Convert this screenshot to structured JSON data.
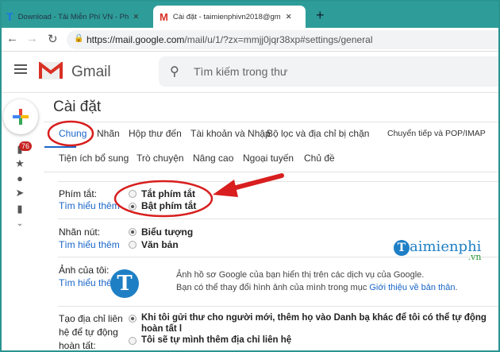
{
  "browser": {
    "tabs": [
      {
        "title": "Download - Tải Miễn Phí VN - Ph",
        "icon": "taimienphi-t-icon"
      },
      {
        "title": "Cài đặt - taimienphivn2018@gm",
        "icon": "gmail-icon"
      }
    ],
    "url_host": "https://mail.google.com",
    "url_path": "/mail/u/1/?zx=mmjj0jqr38xp#settings/general"
  },
  "gmail": {
    "brand": "Gmail",
    "search_placeholder": "Tìm kiếm trong thư",
    "inbox_badge": "76"
  },
  "settings": {
    "title": "Cài đặt",
    "tabs": [
      "Chung",
      "Nhãn",
      "Hộp thư đến",
      "Tài khoản và Nhập",
      "Bộ lọc và địa chỉ bị chặn",
      "Chuyển tiếp và POP/IMAP"
    ],
    "subtabs": [
      "Tiện ích bổ sung",
      "Trò chuyện",
      "Nâng cao",
      "Ngoại tuyến",
      "Chủ đề"
    ],
    "learn_more": "Tìm hiểu thêm",
    "shortcuts": {
      "label": "Phím tắt:",
      "options": [
        "Tắt phím tắt",
        "Bật phím tắt"
      ],
      "selected": 1
    },
    "button_labels": {
      "label": "Nhãn nút:",
      "options": [
        "Biểu tượng",
        "Văn bản"
      ],
      "selected": 0
    },
    "my_picture": {
      "label": "Ảnh của tôi:",
      "line1": "Ảnh hồ sơ Google của bạn hiển thị trên các dịch vụ của Google.",
      "line2": "Bạn có thể thay đổi hình ảnh của mình trong mục ",
      "link": "Giới thiệu về bản thân",
      "end": "."
    },
    "autocomplete": {
      "label_lines": [
        "Tạo địa chỉ liên",
        "hệ để tự động",
        "hoàn tất:"
      ],
      "options": [
        "Khi tôi gửi thư cho người mới, thêm họ vào Danh bạ khác để tôi có thể tự động hoàn tất l",
        "Tôi sẽ tự mình thêm địa chỉ liên hệ"
      ],
      "selected": 0
    }
  },
  "watermark": {
    "text": "aimienphi",
    "suffix": ".vn"
  },
  "colors": {
    "teal": "#2e9d99",
    "annotation_red": "#d81e1e",
    "link": "#1a66c9"
  }
}
